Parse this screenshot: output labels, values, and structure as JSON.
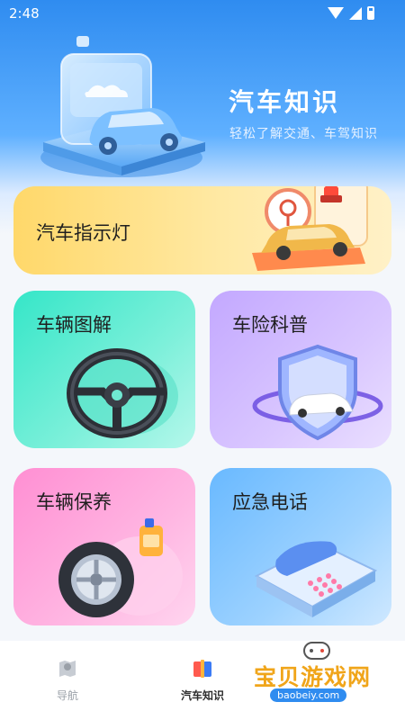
{
  "status_bar": {
    "time": "2:48"
  },
  "header": {
    "title": "汽车知识",
    "subtitle": "轻松了解交通、车驾知识"
  },
  "cards": {
    "indicator": {
      "label": "汽车指示灯"
    },
    "diagram": {
      "label": "车辆图解"
    },
    "insurance": {
      "label": "车险科普"
    },
    "maintenance": {
      "label": "车辆保养"
    },
    "emergency": {
      "label": "应急电话"
    }
  },
  "nav": {
    "items": [
      {
        "label": "导航",
        "icon": "map-pin-icon",
        "active": false
      },
      {
        "label": "汽车知识",
        "icon": "book-icon",
        "active": true
      },
      {
        "label": "",
        "icon": "hidden-tab-icon",
        "active": false
      }
    ]
  },
  "watermark": {
    "text": "宝贝游戏网",
    "url": "baobeiy.com"
  },
  "colors": {
    "header_blue": "#2f8cf0",
    "card_yellow": "#ffd86a",
    "card_teal": "#35e6c8",
    "card_purple": "#c3a8ff",
    "card_pink": "#ff8fd3",
    "card_blue": "#69b9ff",
    "watermark_orange": "#f0a51a"
  }
}
